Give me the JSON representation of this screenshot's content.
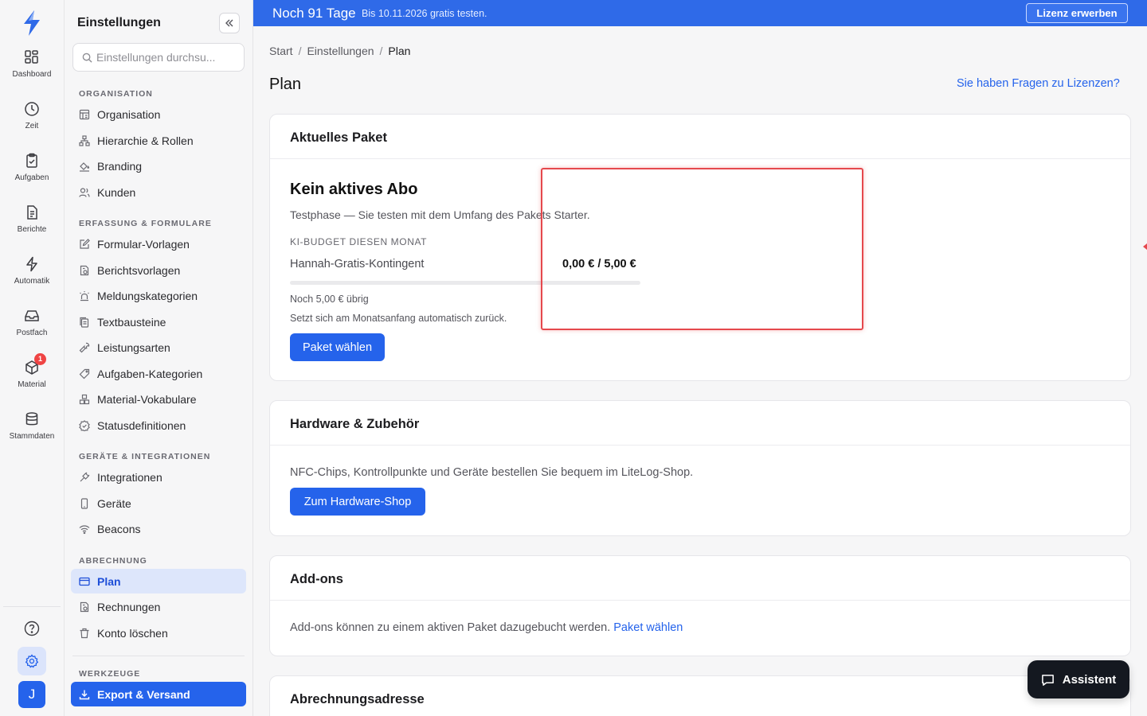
{
  "colors": {
    "accent": "#2563eb",
    "banner": "#2f6ae8",
    "highlight": "#e5484d",
    "assistant_bg": "#141820"
  },
  "rail": {
    "items": [
      {
        "label": "Dashboard",
        "icon": "grid-icon"
      },
      {
        "label": "Zeit",
        "icon": "clock-icon"
      },
      {
        "label": "Aufgaben",
        "icon": "clipboard-check-icon"
      },
      {
        "label": "Berichte",
        "icon": "document-icon"
      },
      {
        "label": "Automatik",
        "icon": "lightning-icon"
      },
      {
        "label": "Postfach",
        "icon": "inbox-icon"
      },
      {
        "label": "Material",
        "icon": "box-icon",
        "badge": "1"
      },
      {
        "label": "Stammdaten",
        "icon": "database-icon"
      }
    ],
    "avatar_initial": "J"
  },
  "sidebar": {
    "title": "Einstellungen",
    "search_placeholder": "Einstellungen durchsu...",
    "sections": [
      {
        "heading": "ORGANISATION",
        "items": [
          "Organisation",
          "Hierarchie & Rollen",
          "Branding",
          "Kunden"
        ]
      },
      {
        "heading": "ERFASSUNG & FORMULARE",
        "items": [
          "Formular-Vorlagen",
          "Berichtsvorlagen",
          "Meldungskategorien",
          "Textbausteine",
          "Leistungsarten",
          "Aufgaben-Kategorien",
          "Material-Vokabulare",
          "Statusdefinitionen"
        ]
      },
      {
        "heading": "GERÄTE & INTEGRATIONEN",
        "items": [
          "Integrationen",
          "Geräte",
          "Beacons"
        ]
      },
      {
        "heading": "ABRECHNUNG",
        "items": [
          "Plan",
          "Rechnungen",
          "Konto löschen"
        ]
      },
      {
        "heading": "WERKZEUGE",
        "items": [
          "Export & Versand"
        ]
      }
    ]
  },
  "banner": {
    "title": "Noch 91 Tage",
    "subtitle": "Bis 10.11.2026 gratis testen.",
    "button": "Lizenz erwerben"
  },
  "breadcrumb": [
    "Start",
    "Einstellungen",
    "Plan"
  ],
  "page": {
    "title": "Plan",
    "help_link": "Sie haben Fragen zu Lizenzen?"
  },
  "current_package": {
    "heading": "Aktuelles Paket",
    "status_title": "Kein aktives Abo",
    "status_subtitle": "Testphase — Sie testen mit dem Umfang des Pakets Starter.",
    "budget_caption": "KI-BUDGET DIESEN MONAT",
    "budget_name": "Hannah-Gratis-Kontingent",
    "budget_amount": "0,00 € / 5,00 €",
    "budget_used_fraction": 0,
    "remaining": "Noch 5,00 € übrig",
    "reset_note": "Setzt sich am Monatsanfang automatisch zurück.",
    "button": "Paket wählen"
  },
  "hardware": {
    "heading": "Hardware & Zubehör",
    "text": "NFC-Chips, Kontrollpunkte und Geräte bestellen Sie bequem im LiteLog-Shop.",
    "button": "Zum Hardware-Shop"
  },
  "addons": {
    "heading": "Add-ons",
    "text": "Add-ons können zu einem aktiven Paket dazugebucht werden.",
    "link": "Paket wählen"
  },
  "billing_address": {
    "heading": "Abrechnungsadresse"
  },
  "assistant": {
    "label": "Assistent"
  }
}
